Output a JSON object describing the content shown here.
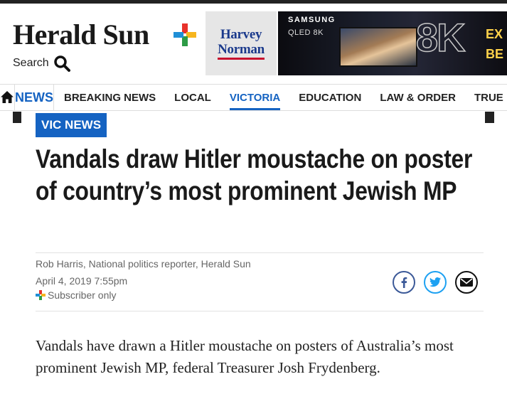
{
  "masthead": {
    "logo": "Herald Sun",
    "search_label": "Search",
    "brand_plus_colors": [
      "#e8322b",
      "#f6b51e",
      "#2d9b46",
      "#1f8fd6"
    ]
  },
  "ads": {
    "harvey_norman": {
      "line1": "Harvey",
      "line2": "Norman"
    },
    "samsung": {
      "brand": "SAMSUNG",
      "product": "QLED 8K",
      "badge": "8K",
      "cta_line1": "EX",
      "cta_line2": "BE"
    }
  },
  "nav": {
    "home_icon": "home-icon",
    "section": "NEWS",
    "items": [
      {
        "label": "BREAKING NEWS",
        "active": false
      },
      {
        "label": "LOCAL",
        "active": false
      },
      {
        "label": "VICTORIA",
        "active": true
      },
      {
        "label": "EDUCATION",
        "active": false
      },
      {
        "label": "LAW & ORDER",
        "active": false
      },
      {
        "label": "TRUE",
        "active": false
      }
    ],
    "accent": "#1563c2"
  },
  "article": {
    "tag": "VIC NEWS",
    "headline": "Vandals draw Hitler moustache on poster of country’s most prominent Jewish MP",
    "byline": "Rob Harris, National politics reporter, Herald Sun",
    "date": "April 4, 2019 7:55pm",
    "access": "Subscriber only",
    "share": [
      "facebook-icon",
      "twitter-icon",
      "email-icon"
    ],
    "intro": "Vandals have drawn a Hitler moustache on posters of Australia’s most prominent Jewish MP, federal Treasurer Josh Frydenberg."
  }
}
